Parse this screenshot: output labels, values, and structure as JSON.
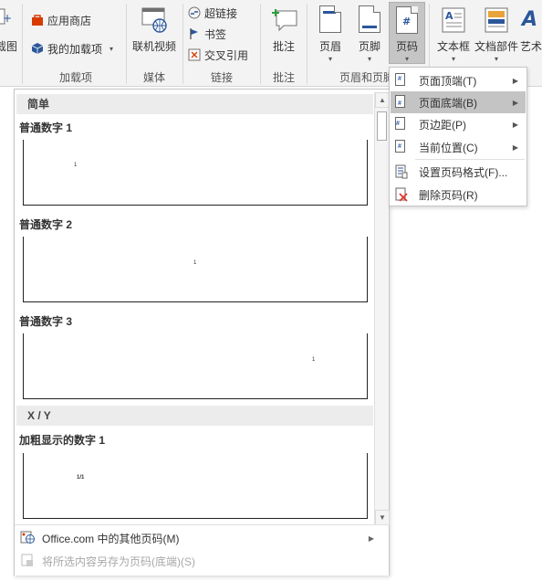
{
  "ribbon": {
    "screenshot_label": "截图",
    "app_store_label": "应用商店",
    "my_addins_label": "我的加载项",
    "addins_group": "加载项",
    "online_video_label": "联机视频",
    "media_group": "媒体",
    "hyperlink_label": "超链接",
    "bookmark_label": "书签",
    "cross_ref_label": "交叉引用",
    "links_group": "链接",
    "comment_label": "批注",
    "comments_group": "批注",
    "header_label": "页眉",
    "footer_label": "页脚",
    "page_number_label": "页码",
    "header_footer_group": "页眉和页脚",
    "textbox_label": "文本框",
    "quick_parts_label": "文档部件",
    "wordart_label": "艺术"
  },
  "gallery": {
    "sections": [
      {
        "header": "简单"
      },
      {
        "header": "X / Y"
      }
    ],
    "items": [
      {
        "title": "普通数字 1",
        "sample": "1"
      },
      {
        "title": "普通数字 2",
        "sample": "1"
      },
      {
        "title": "普通数字 3",
        "sample": "1"
      },
      {
        "title": "加粗显示的数字 1",
        "sample": "1/1"
      }
    ],
    "footer": {
      "more_label": "Office.com 中的其他页码(M)",
      "save_label": "将所选内容另存为页码(底端)(S)"
    }
  },
  "menu": {
    "items": [
      {
        "label": "页面顶端(T)"
      },
      {
        "label": "页面底端(B)"
      },
      {
        "label": "页边距(P)"
      },
      {
        "label": "当前位置(C)"
      },
      {
        "label": "设置页码格式(F)..."
      },
      {
        "label": "删除页码(R)"
      }
    ]
  },
  "colors": {
    "accent": "#2b579a",
    "highlight": "#c4c4c4",
    "ribbon_bg": "#f3f3f3"
  }
}
